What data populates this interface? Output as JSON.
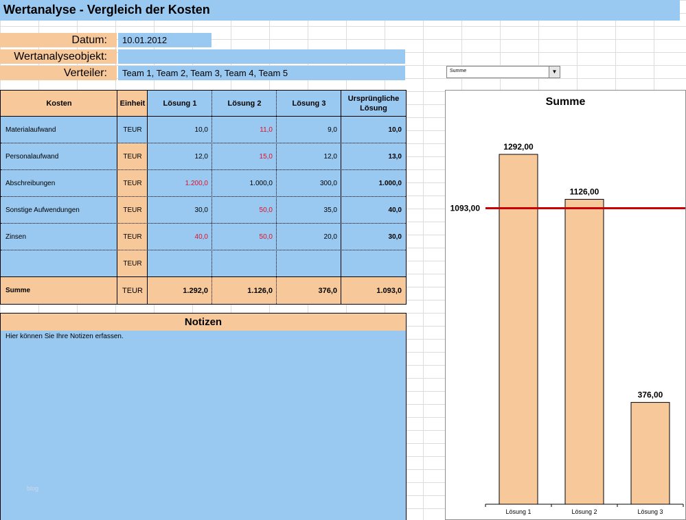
{
  "title": "Wertanalyse - Vergleich der Kosten",
  "header": {
    "datum_label": "Datum:",
    "datum_value": "10.01.2012",
    "objekt_label": "Wertanalyseobjekt:",
    "objekt_value": "",
    "verteiler_label": "Verteiler:",
    "verteiler_value": "Team 1, Team 2, Team 3, Team 4, Team 5"
  },
  "dropdown": {
    "value": "Summe",
    "arrow": "▼"
  },
  "table": {
    "headers": [
      "Kosten",
      "Einheit",
      "Lösung 1",
      "Lösung 2",
      "Lösung 3",
      "Ursprüngliche Lösung"
    ],
    "rows": [
      {
        "kosten": "Materialaufwand",
        "einheit": "TEUR",
        "l1": "10,0",
        "l2": "11,0",
        "l3": "9,0",
        "orig": "10,0"
      },
      {
        "kosten": "Personalaufwand",
        "einheit": "TEUR",
        "l1": "12,0",
        "l2": "15,0",
        "l3": "12,0",
        "orig": "13,0"
      },
      {
        "kosten": "Abschreibungen",
        "einheit": "TEUR",
        "l1": "1.200,0",
        "l2": "1.000,0",
        "l3": "300,0",
        "orig": "1.000,0"
      },
      {
        "kosten": "Sonstige Aufwendungen",
        "einheit": "TEUR",
        "l1": "30,0",
        "l2": "50,0",
        "l3": "35,0",
        "orig": "40,0"
      },
      {
        "kosten": "Zinsen",
        "einheit": "TEUR",
        "l1": "40,0",
        "l2": "50,0",
        "l3": "20,0",
        "orig": "30,0"
      },
      {
        "kosten": "",
        "einheit": "TEUR",
        "l1": "",
        "l2": "",
        "l3": "",
        "orig": ""
      }
    ],
    "sum": {
      "kosten": "Summe",
      "einheit": "TEUR",
      "l1": "1.292,0",
      "l2": "1.126,0",
      "l3": "376,0",
      "orig": "1.093,0"
    }
  },
  "notes": {
    "title": "Notizen",
    "text": "Hier können Sie Ihre Notizen erfassen.",
    "watermark": "blog"
  },
  "chart_data": {
    "type": "bar",
    "title": "Summe",
    "categories": [
      "Lösung 1",
      "Lösung 2",
      "Lösung 3"
    ],
    "values": [
      1292,
      1126,
      376
    ],
    "value_labels": [
      "1292,00",
      "1126,00",
      "376,00"
    ],
    "reference_line": {
      "value": 1093,
      "label": "1093,00",
      "color": "#cc0000"
    },
    "bar_color": "#f7c89a",
    "ylim": [
      0,
      1400
    ]
  },
  "colors": {
    "blue": "#99c8f0",
    "orange": "#f7c89a",
    "red_text": "#e0102a"
  }
}
